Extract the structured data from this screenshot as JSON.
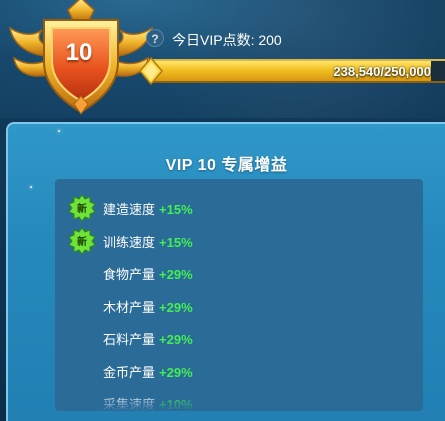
{
  "vip": {
    "level": "10",
    "today_points_text": "今日VIP点数: 200",
    "progress_text": "238,540/250,000",
    "progress_fraction": 0.954
  },
  "info_icon_text": "?",
  "panel": {
    "title": "VIP 10 专属增益",
    "benefits": [
      {
        "name": "建造速度",
        "value": "+15%",
        "new_badge": "新"
      },
      {
        "name": "训练速度",
        "value": "+15%",
        "new_badge": "新"
      },
      {
        "name": "食物产量",
        "value": "+29%",
        "new_badge": ""
      },
      {
        "name": "木材产量",
        "value": "+29%",
        "new_badge": ""
      },
      {
        "name": "石料产量",
        "value": "+29%",
        "new_badge": ""
      },
      {
        "name": "金币产量",
        "value": "+29%",
        "new_badge": ""
      },
      {
        "name": "采集速度",
        "value": "+10%",
        "new_badge": ""
      }
    ]
  },
  "colors": {
    "accent_gold": "#f2c021",
    "bonus_green": "#41ef52",
    "panel_blue": "#2688bb"
  }
}
